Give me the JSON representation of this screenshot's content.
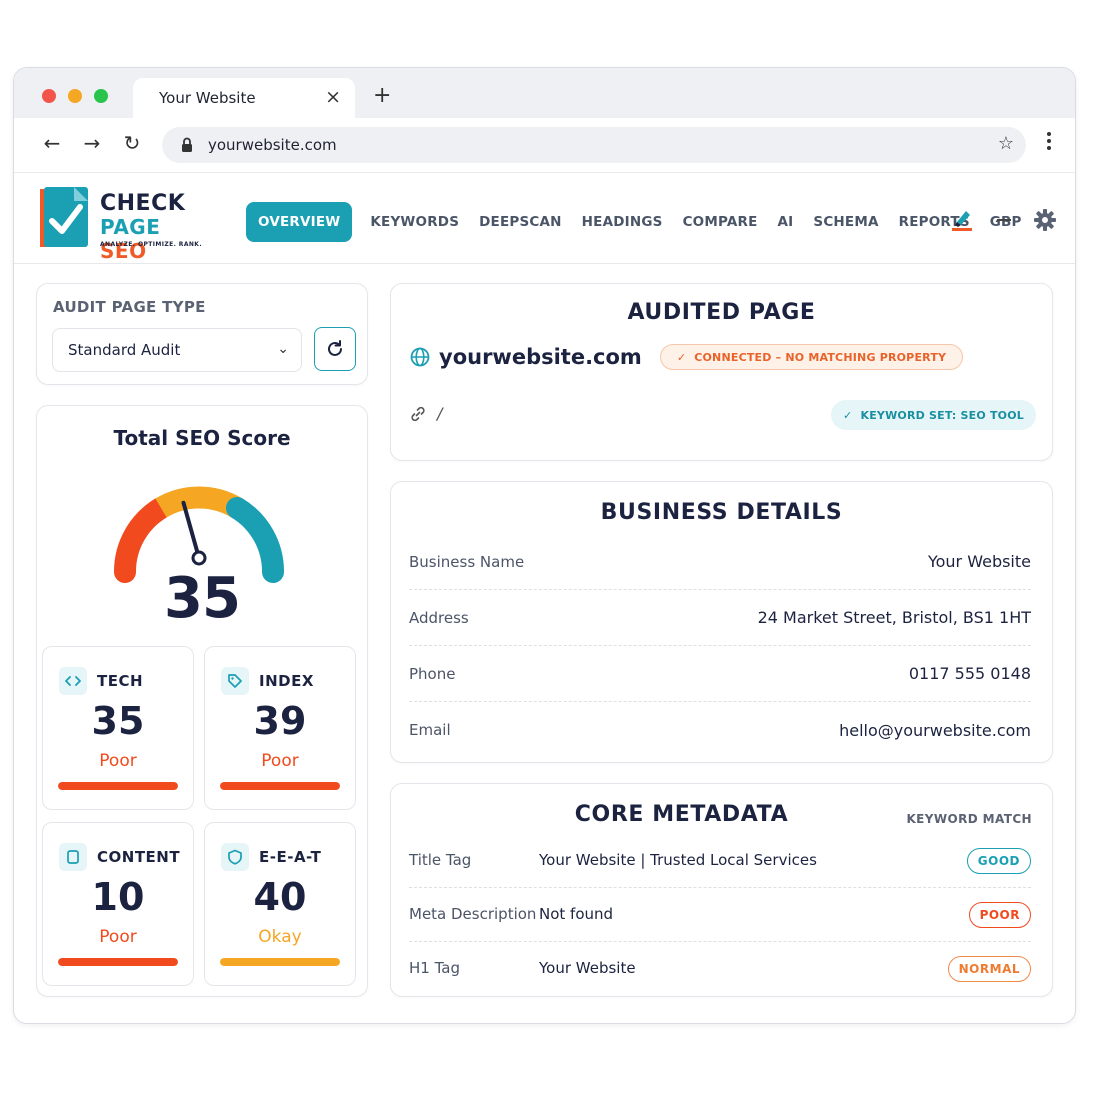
{
  "browser": {
    "tab_title": "Your Website",
    "url": "yourwebsite.com"
  },
  "logo": {
    "line1": "CHECK",
    "line2_a": "PAGE",
    "line2_b": "SEO",
    "tagline": "ANALYZE. OPTIMIZE. RANK."
  },
  "nav": {
    "items": [
      {
        "label": "OVERVIEW",
        "active": true
      },
      {
        "label": "KEYWORDS"
      },
      {
        "label": "DEEPSCAN"
      },
      {
        "label": "HEADINGS"
      },
      {
        "label": "COMPARE"
      },
      {
        "label": "AI"
      },
      {
        "label": "SCHEMA"
      },
      {
        "label": "REPORTS"
      },
      {
        "label": "GBP"
      }
    ]
  },
  "audit_type": {
    "label": "AUDIT PAGE TYPE",
    "selected": "Standard Audit"
  },
  "score": {
    "title": "Total SEO Score",
    "value": "35",
    "value_num": 35,
    "subs": [
      {
        "label": "TECH",
        "value": "35",
        "rating": "Poor",
        "icon": "code-icon"
      },
      {
        "label": "INDEX",
        "value": "39",
        "rating": "Poor",
        "icon": "tag-icon"
      },
      {
        "label": "CONTENT",
        "value": "10",
        "rating": "Poor",
        "icon": "document-icon"
      },
      {
        "label": "E-E-A-T",
        "value": "40",
        "rating": "Okay",
        "icon": "shield-icon"
      }
    ]
  },
  "audited": {
    "title": "AUDITED PAGE",
    "domain": "yourwebsite.com",
    "status": "CONNECTED – NO MATCHING PROPERTY",
    "path": "/",
    "keyword_set": "KEYWORD SET: SEO TOOL"
  },
  "business": {
    "title": "BUSINESS DETAILS",
    "rows": [
      {
        "key": "Business Name",
        "value": "Your Website"
      },
      {
        "key": "Address",
        "value": "24 Market Street, Bristol, BS1 1HT"
      },
      {
        "key": "Phone",
        "value": "0117 555 0148"
      },
      {
        "key": "Email",
        "value": "hello@yourwebsite.com"
      }
    ]
  },
  "meta": {
    "title": "CORE METADATA",
    "keyword_match_label": "KEYWORD MATCH",
    "rows": [
      {
        "key": "Title Tag",
        "value": "Your Website | Trusted Local Services",
        "match": "GOOD"
      },
      {
        "key": "Meta Description",
        "value": "Not found",
        "match": "POOR"
      },
      {
        "key": "H1 Tag",
        "value": "Your Website",
        "match": "NORMAL"
      }
    ]
  },
  "colors": {
    "brand": "#1a9fb3",
    "poor": "#f04a1e",
    "okay": "#f5a623",
    "navy": "#1c2340"
  }
}
